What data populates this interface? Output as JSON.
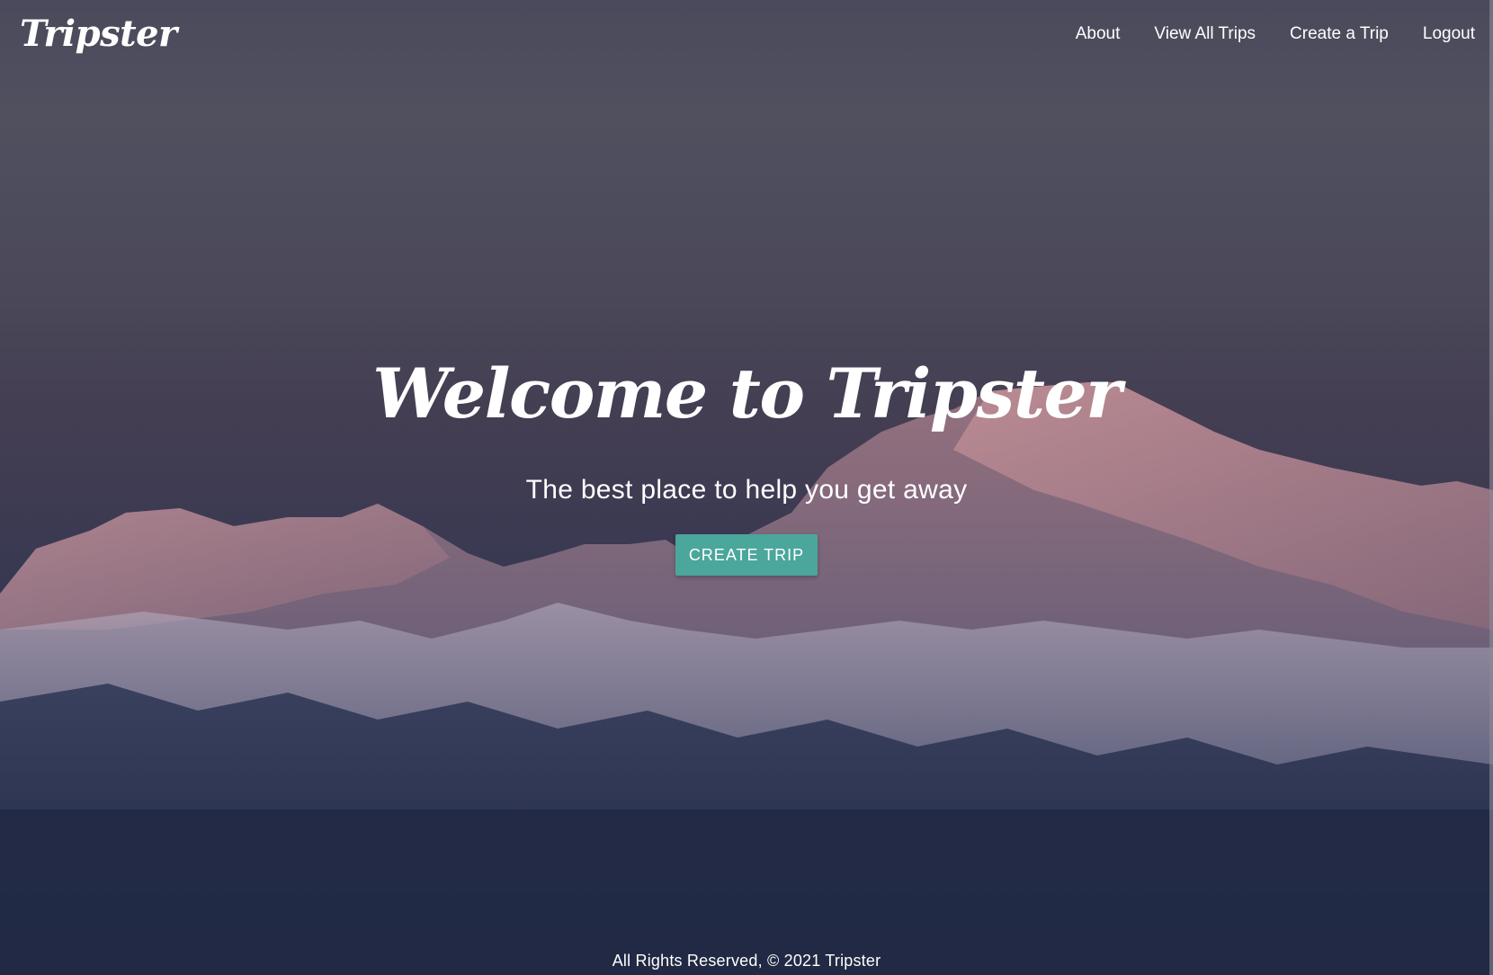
{
  "navbar": {
    "logo": "Tripster",
    "links": [
      {
        "label": "About"
      },
      {
        "label": "View All Trips"
      },
      {
        "label": "Create a Trip"
      },
      {
        "label": "Logout"
      }
    ]
  },
  "hero": {
    "title": "Welcome to Tripster",
    "subtitle": "The best place to help you get away",
    "button_label": "CREATE TRIP"
  },
  "footer": {
    "text": "All Rights Reserved, © 2021 Tripster"
  },
  "colors": {
    "accent": "#4ba69c",
    "sky_top": "#50505f",
    "sky_bottom": "#222a46",
    "text": "#ffffff"
  }
}
